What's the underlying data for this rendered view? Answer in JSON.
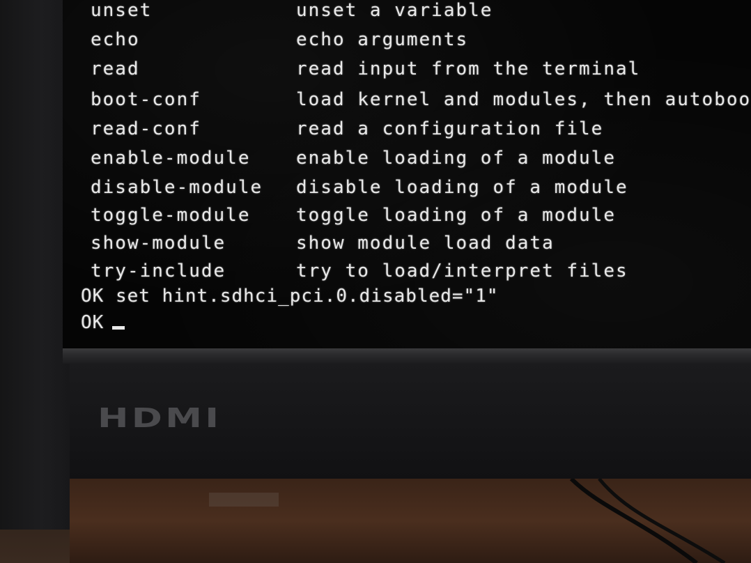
{
  "terminal": {
    "commands": [
      {
        "name": "unset",
        "description": "unset a variable"
      },
      {
        "name": "echo",
        "description": "echo arguments"
      },
      {
        "name": "read",
        "description": "read input from the terminal"
      },
      {
        "name": "boot-conf",
        "description": "load kernel and modules, then autoboo"
      },
      {
        "name": "read-conf",
        "description": "read a configuration file"
      },
      {
        "name": "enable-module",
        "description": "enable loading of a module"
      },
      {
        "name": "disable-module",
        "description": "disable loading of a module"
      },
      {
        "name": "toggle-module",
        "description": "toggle loading of a module"
      },
      {
        "name": "show-module",
        "description": "show module load data"
      },
      {
        "name": "try-include",
        "description": "try to load/interpret files"
      }
    ],
    "set_line": "OK set hint.sdhci_pci.0.disabled=\"1\"",
    "prompt": "OK"
  },
  "monitor": {
    "logo": "HDMI"
  },
  "colors": {
    "screen_bg": "#050505",
    "text": "#e8e8e8",
    "bezel": "#1b1b1d",
    "desk": "#3a2418"
  }
}
